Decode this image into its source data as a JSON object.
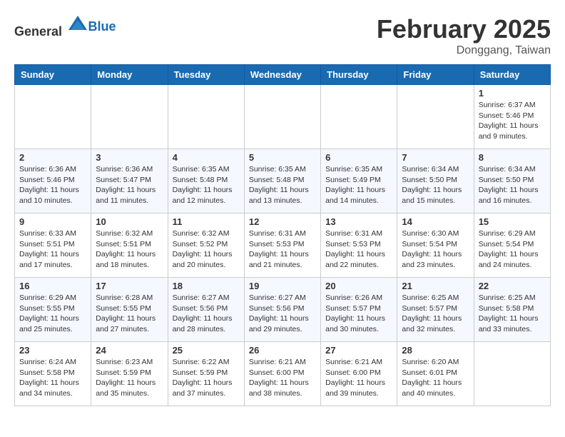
{
  "header": {
    "logo": {
      "general": "General",
      "blue": "Blue"
    },
    "title": "February 2025",
    "location": "Donggang, Taiwan"
  },
  "calendar": {
    "days_of_week": [
      "Sunday",
      "Monday",
      "Tuesday",
      "Wednesday",
      "Thursday",
      "Friday",
      "Saturday"
    ],
    "weeks": [
      [
        {
          "day": "",
          "info": ""
        },
        {
          "day": "",
          "info": ""
        },
        {
          "day": "",
          "info": ""
        },
        {
          "day": "",
          "info": ""
        },
        {
          "day": "",
          "info": ""
        },
        {
          "day": "",
          "info": ""
        },
        {
          "day": "1",
          "info": "Sunrise: 6:37 AM\nSunset: 5:46 PM\nDaylight: 11 hours\nand 9 minutes."
        }
      ],
      [
        {
          "day": "2",
          "info": "Sunrise: 6:36 AM\nSunset: 5:46 PM\nDaylight: 11 hours\nand 10 minutes."
        },
        {
          "day": "3",
          "info": "Sunrise: 6:36 AM\nSunset: 5:47 PM\nDaylight: 11 hours\nand 11 minutes."
        },
        {
          "day": "4",
          "info": "Sunrise: 6:35 AM\nSunset: 5:48 PM\nDaylight: 11 hours\nand 12 minutes."
        },
        {
          "day": "5",
          "info": "Sunrise: 6:35 AM\nSunset: 5:48 PM\nDaylight: 11 hours\nand 13 minutes."
        },
        {
          "day": "6",
          "info": "Sunrise: 6:35 AM\nSunset: 5:49 PM\nDaylight: 11 hours\nand 14 minutes."
        },
        {
          "day": "7",
          "info": "Sunrise: 6:34 AM\nSunset: 5:50 PM\nDaylight: 11 hours\nand 15 minutes."
        },
        {
          "day": "8",
          "info": "Sunrise: 6:34 AM\nSunset: 5:50 PM\nDaylight: 11 hours\nand 16 minutes."
        }
      ],
      [
        {
          "day": "9",
          "info": "Sunrise: 6:33 AM\nSunset: 5:51 PM\nDaylight: 11 hours\nand 17 minutes."
        },
        {
          "day": "10",
          "info": "Sunrise: 6:32 AM\nSunset: 5:51 PM\nDaylight: 11 hours\nand 18 minutes."
        },
        {
          "day": "11",
          "info": "Sunrise: 6:32 AM\nSunset: 5:52 PM\nDaylight: 11 hours\nand 20 minutes."
        },
        {
          "day": "12",
          "info": "Sunrise: 6:31 AM\nSunset: 5:53 PM\nDaylight: 11 hours\nand 21 minutes."
        },
        {
          "day": "13",
          "info": "Sunrise: 6:31 AM\nSunset: 5:53 PM\nDaylight: 11 hours\nand 22 minutes."
        },
        {
          "day": "14",
          "info": "Sunrise: 6:30 AM\nSunset: 5:54 PM\nDaylight: 11 hours\nand 23 minutes."
        },
        {
          "day": "15",
          "info": "Sunrise: 6:29 AM\nSunset: 5:54 PM\nDaylight: 11 hours\nand 24 minutes."
        }
      ],
      [
        {
          "day": "16",
          "info": "Sunrise: 6:29 AM\nSunset: 5:55 PM\nDaylight: 11 hours\nand 25 minutes."
        },
        {
          "day": "17",
          "info": "Sunrise: 6:28 AM\nSunset: 5:55 PM\nDaylight: 11 hours\nand 27 minutes."
        },
        {
          "day": "18",
          "info": "Sunrise: 6:27 AM\nSunset: 5:56 PM\nDaylight: 11 hours\nand 28 minutes."
        },
        {
          "day": "19",
          "info": "Sunrise: 6:27 AM\nSunset: 5:56 PM\nDaylight: 11 hours\nand 29 minutes."
        },
        {
          "day": "20",
          "info": "Sunrise: 6:26 AM\nSunset: 5:57 PM\nDaylight: 11 hours\nand 30 minutes."
        },
        {
          "day": "21",
          "info": "Sunrise: 6:25 AM\nSunset: 5:57 PM\nDaylight: 11 hours\nand 32 minutes."
        },
        {
          "day": "22",
          "info": "Sunrise: 6:25 AM\nSunset: 5:58 PM\nDaylight: 11 hours\nand 33 minutes."
        }
      ],
      [
        {
          "day": "23",
          "info": "Sunrise: 6:24 AM\nSunset: 5:58 PM\nDaylight: 11 hours\nand 34 minutes."
        },
        {
          "day": "24",
          "info": "Sunrise: 6:23 AM\nSunset: 5:59 PM\nDaylight: 11 hours\nand 35 minutes."
        },
        {
          "day": "25",
          "info": "Sunrise: 6:22 AM\nSunset: 5:59 PM\nDaylight: 11 hours\nand 37 minutes."
        },
        {
          "day": "26",
          "info": "Sunrise: 6:21 AM\nSunset: 6:00 PM\nDaylight: 11 hours\nand 38 minutes."
        },
        {
          "day": "27",
          "info": "Sunrise: 6:21 AM\nSunset: 6:00 PM\nDaylight: 11 hours\nand 39 minutes."
        },
        {
          "day": "28",
          "info": "Sunrise: 6:20 AM\nSunset: 6:01 PM\nDaylight: 11 hours\nand 40 minutes."
        },
        {
          "day": "",
          "info": ""
        }
      ]
    ]
  }
}
